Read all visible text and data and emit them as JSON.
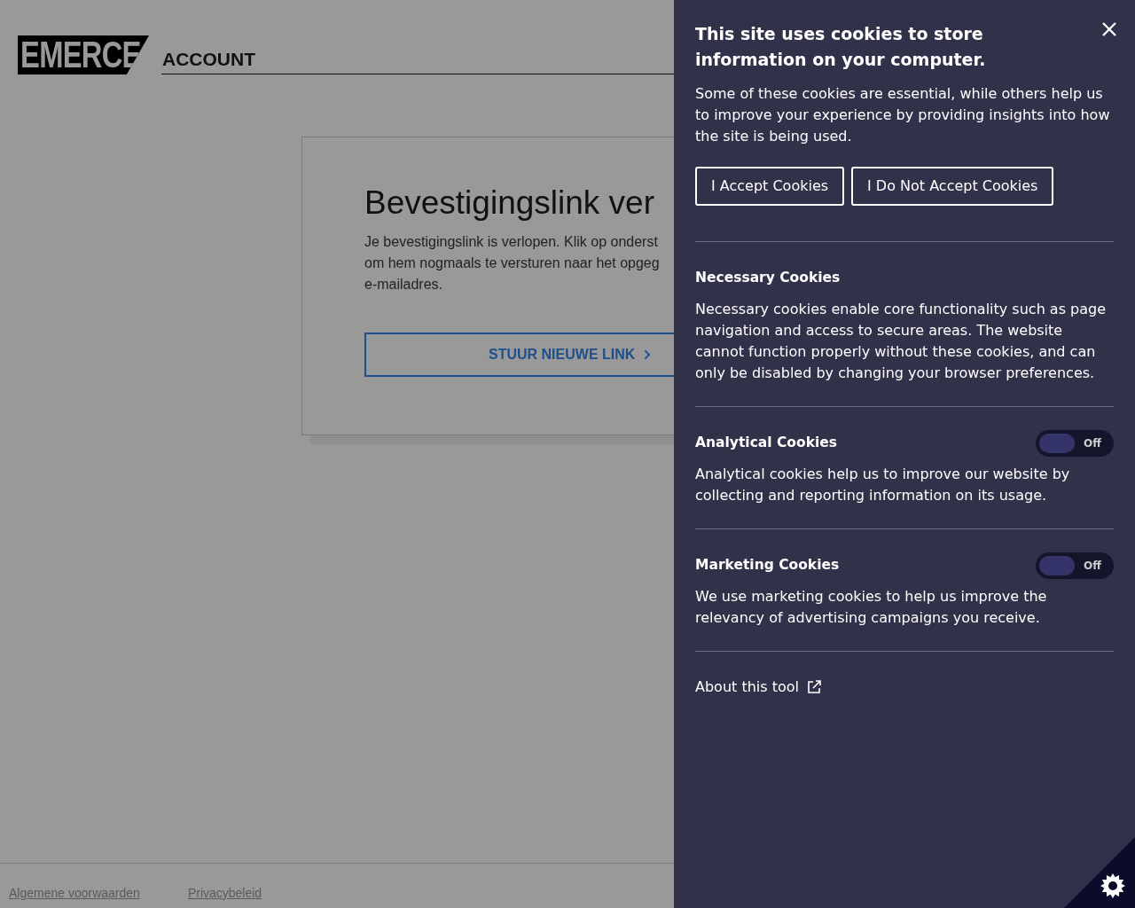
{
  "header": {
    "logo": "EMERCE",
    "section": "ACCOUNT"
  },
  "card": {
    "title": "Bevestigingslink ver",
    "text_lines": [
      "Je bevestigingslink is verlopen. Klik op onderst",
      "om hem nogmaals te versturen naar het opgeg",
      "e-mailadres."
    ],
    "button": "STUUR NIEUWE LINK"
  },
  "footer": {
    "links": [
      "Algemene voorwaarden",
      "Privacybeleid"
    ]
  },
  "cookie_panel": {
    "title": "This site uses cookies to store information on your computer.",
    "intro": "Some of these cookies are essential, while others help us to improve your experience by providing insights into how the site is being used.",
    "buttons": [
      "I Accept Cookies",
      "I Do Not Accept Cookies"
    ],
    "categories": [
      {
        "kind": "fixed",
        "title": "Necessary Cookies",
        "text": "Necessary cookies enable core functionality such as page navigation and access to secure areas. The website cannot function properly without these cookies, and can only be disabled by changing your browser preferences."
      },
      {
        "kind": "toggle",
        "title": "Analytical Cookies",
        "on": false,
        "toggle_label": "Off",
        "text": "Analytical cookies help us to improve our website by collecting and reporting information on its usage."
      },
      {
        "kind": "toggle",
        "title": "Marketing Cookies",
        "on": false,
        "toggle_label": "Off",
        "text": "We use marketing cookies to help us improve the relevancy of advertising campaigns you receive."
      }
    ],
    "about_link": "About this tool"
  }
}
